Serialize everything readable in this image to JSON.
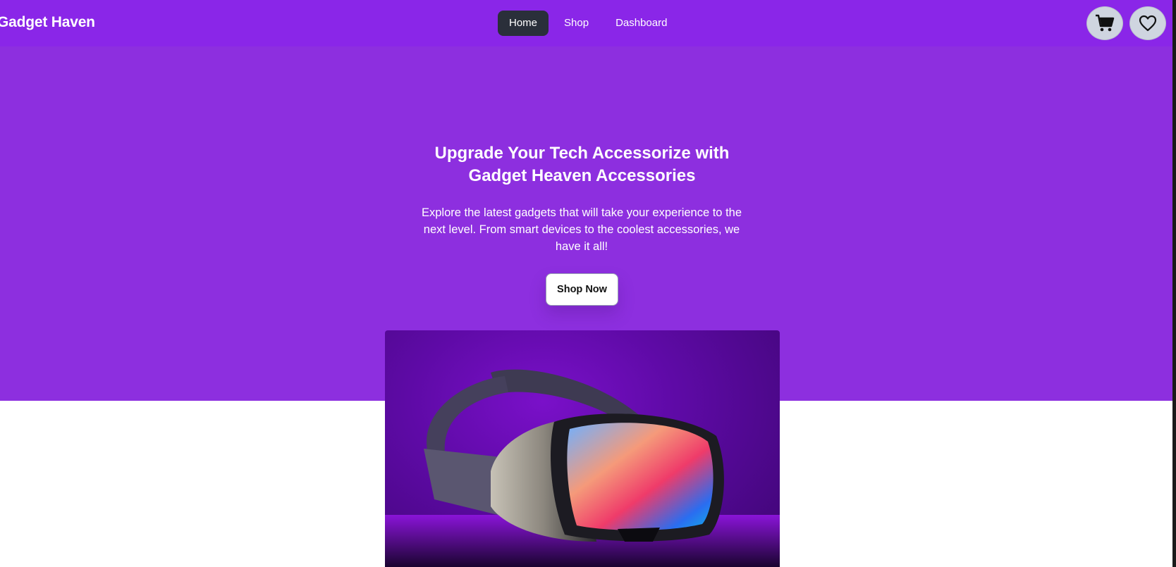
{
  "navbar": {
    "brand": "Gadget Haven",
    "links": [
      {
        "label": "Home",
        "active": true
      },
      {
        "label": "Shop",
        "active": false
      },
      {
        "label": "Dashboard",
        "active": false
      }
    ],
    "cart_icon": "cart-icon",
    "wishlist_icon": "heart-icon"
  },
  "hero": {
    "title_line1": "Upgrade Your Tech Accessorize with",
    "title_line2": "Gadget Heaven Accessories",
    "subtitle": "Explore the latest gadgets that will take your experience to the next level. From smart devices to the coolest accessories, we have it all!",
    "cta_label": "Shop Now",
    "image_subject": "vr-headset"
  },
  "colors": {
    "brand_purple": "#8a26e8",
    "hero_purple": "#8d2fdf",
    "active_nav": "#2a2f3a",
    "icon_button": "#cfd5e0"
  }
}
